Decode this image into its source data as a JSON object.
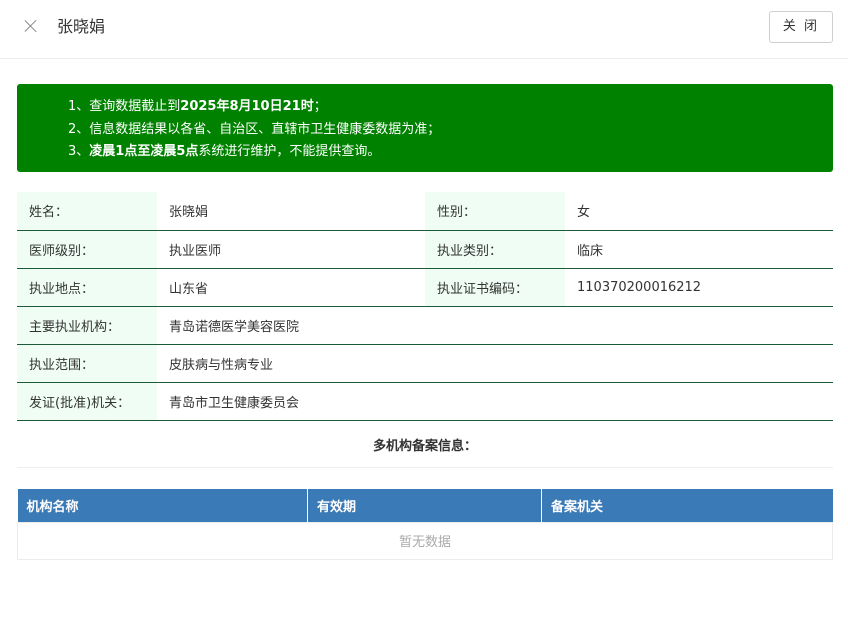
{
  "header": {
    "title": "张晓娟",
    "close_button_label": "关 闭"
  },
  "notice": {
    "lines": [
      {
        "prefix": "1、查询数据截止到",
        "bold": "2025年8月10日21时",
        "suffix": "；"
      },
      {
        "prefix": "2、信息数据结果以各省、自治区、直辖市卫生健康委数据为准；",
        "bold": "",
        "suffix": ""
      },
      {
        "prefix": "3、",
        "bold": "凌晨1点至凌晨5点",
        "suffix": "系统进行维护，不能提供查询。"
      }
    ]
  },
  "info": {
    "name_label": "姓名：",
    "name_value": "张晓娟",
    "gender_label": "性别：",
    "gender_value": "女",
    "level_label": "医师级别：",
    "level_value": "执业医师",
    "category_label": "执业类别：",
    "category_value": "临床",
    "location_label": "执业地点：",
    "location_value": "山东省",
    "cert_label": "执业证书编码：",
    "cert_value": "110370200016212",
    "institution_label": "主要执业机构：",
    "institution_value": "青岛诺德医学美容医院",
    "scope_label": "执业范围：",
    "scope_value": "皮肤病与性病专业",
    "authority_label": "发证(批准)机关：",
    "authority_value": "青岛市卫生健康委员会"
  },
  "multi_registration": {
    "title": "多机构备案信息：",
    "columns": [
      "机构名称",
      "有效期",
      "备案机关"
    ],
    "empty_text": "暂无数据"
  },
  "colors": {
    "notice_bg": "#008200",
    "label_bg": "#effdf4",
    "table_header_bg": "#3a7ab6",
    "row_border": "#1d5a3a"
  }
}
